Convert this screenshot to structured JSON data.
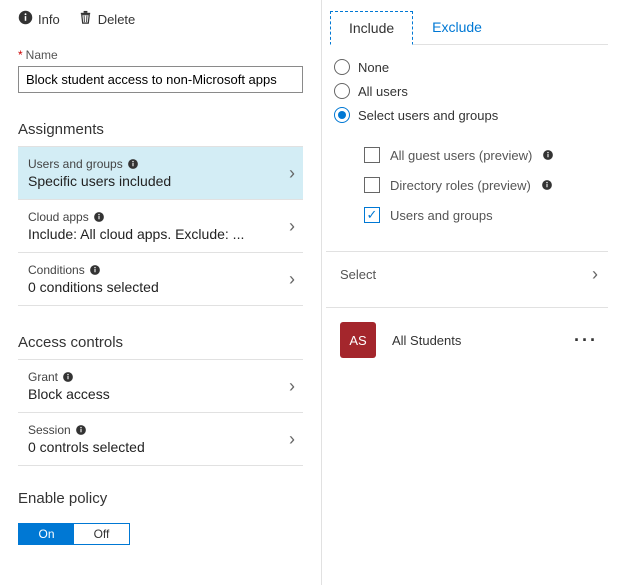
{
  "toolbar": {
    "info_label": "Info",
    "delete_label": "Delete"
  },
  "name_field": {
    "label": "Name",
    "value": "Block student access to non-Microsoft apps"
  },
  "sections": {
    "assignments": "Assignments",
    "access_controls": "Access controls",
    "enable_policy": "Enable policy"
  },
  "assignments": {
    "users_groups": {
      "title": "Users and groups",
      "sub": "Specific users included"
    },
    "cloud_apps": {
      "title": "Cloud apps",
      "sub": "Include: All cloud apps. Exclude: ..."
    },
    "conditions": {
      "title": "Conditions",
      "sub": "0 conditions selected"
    }
  },
  "access_controls": {
    "grant": {
      "title": "Grant",
      "sub": "Block access"
    },
    "session": {
      "title": "Session",
      "sub": "0 controls selected"
    }
  },
  "toggle": {
    "on": "On",
    "off": "Off"
  },
  "tabs": {
    "include": "Include",
    "exclude": "Exclude"
  },
  "radios": {
    "none": "None",
    "all_users": "All users",
    "select_users_groups": "Select users and groups"
  },
  "checkboxes": {
    "all_guest": "All guest users (preview)",
    "directory_roles": "Directory roles (preview)",
    "users_groups": "Users and groups"
  },
  "select_label": "Select",
  "entity": {
    "initials": "AS",
    "label": "All Students"
  }
}
